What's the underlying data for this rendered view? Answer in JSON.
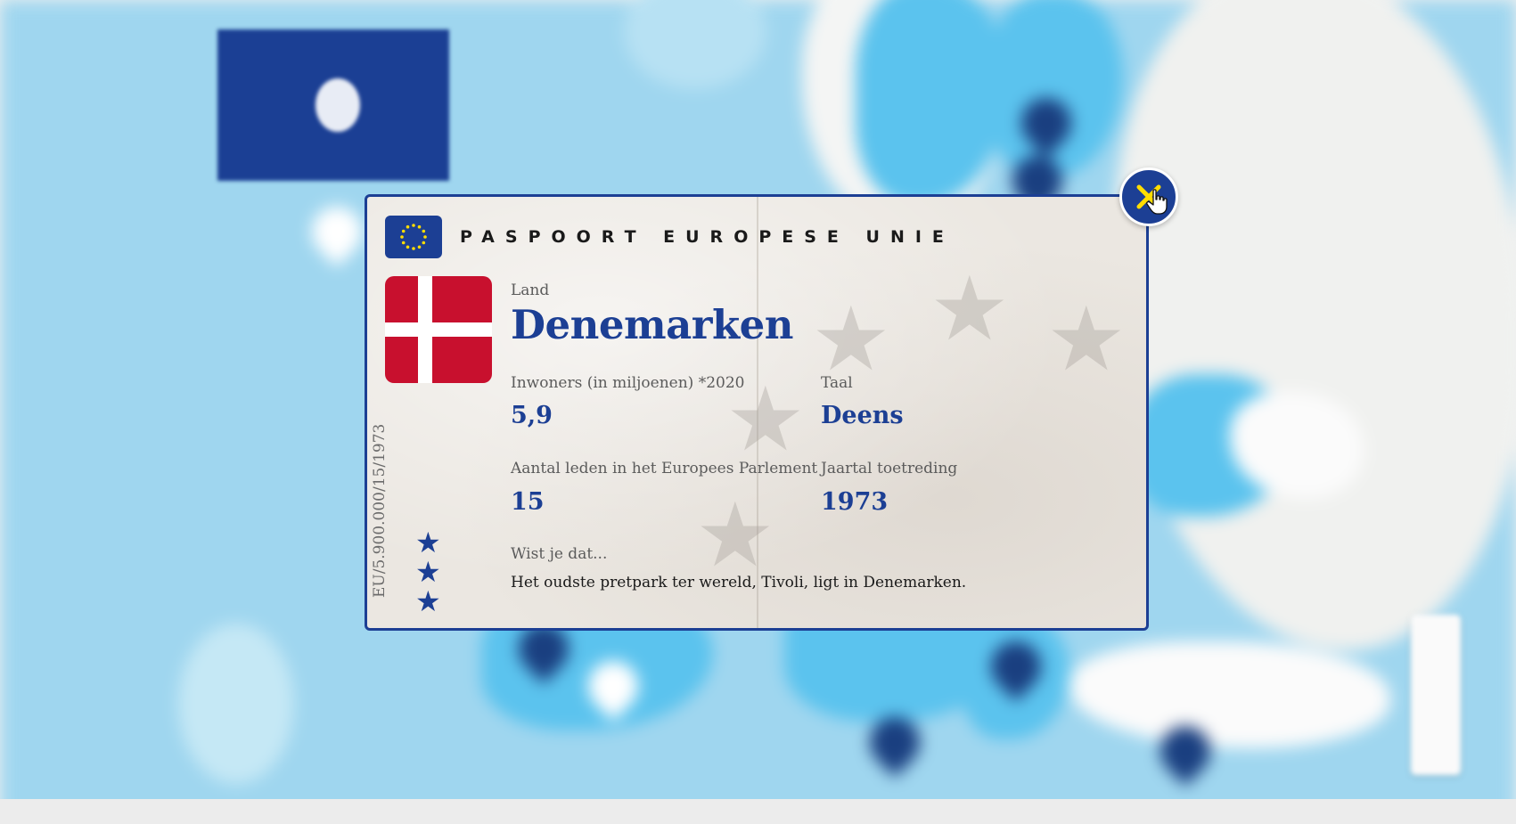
{
  "passport": {
    "title": "PASPOORT EUROPESE UNIE",
    "country_label": "Land",
    "country_name": "Denemarken",
    "population_label": "Inwoners (in miljoenen) *2020",
    "population_value": "5,9",
    "language_label": "Taal",
    "language_value": "Deens",
    "mep_label": "Aantal leden in het Europees Parlement",
    "mep_value": "15",
    "accession_label": "Jaartal toetreding",
    "accession_value": "1973",
    "fact_label": "Wist je dat...",
    "fact_text": "Het oudste pretpark ter wereld, Tivoli, ligt in Denemarken.",
    "vertical_code": "EU/5.900.000/15/1973"
  },
  "colors": {
    "eu_blue": "#1c3f94",
    "eu_yellow": "#ffdd00",
    "denmark_red": "#c8102e",
    "paper": "#ebe7e1"
  },
  "icons": {
    "close": "close-icon",
    "cursor": "hand-pointer-icon",
    "eu_flag": "eu-flag-icon",
    "country_flag": "denmark-flag-icon"
  }
}
